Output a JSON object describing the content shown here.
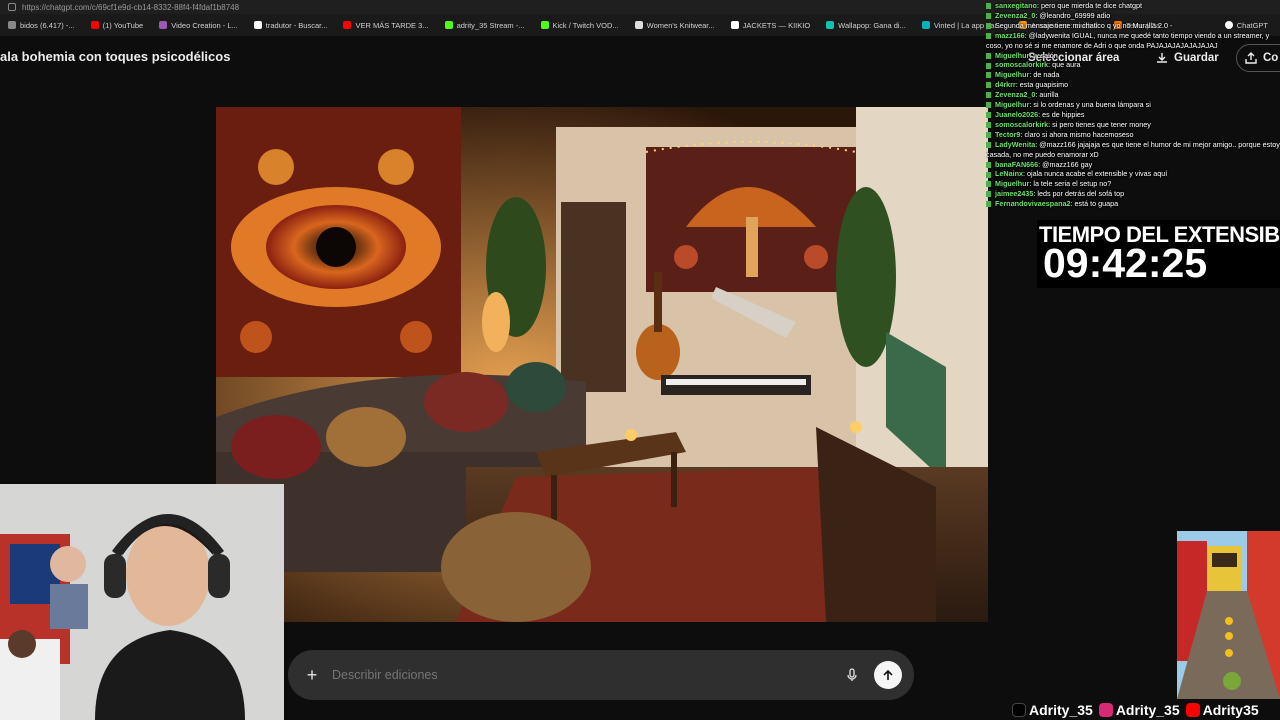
{
  "browser": {
    "url": "https://chatgpt.com/c/69cf1e9d-cb14-8332-88f4-f4fdaf1b8748",
    "bookmarks": [
      {
        "label": "bidos (6.417) -...",
        "color": "#888888"
      },
      {
        "label": "(1) YouTube",
        "color": "#ff0000"
      },
      {
        "label": "Video Creation - L...",
        "color": "#9b59b6"
      },
      {
        "label": "tradutor - Buscar...",
        "color": "#ffffff"
      },
      {
        "label": "VER MÁS TARDE 3...",
        "color": "#ff0000"
      },
      {
        "label": "adrity_35 Stream -...",
        "color": "#53fc18"
      },
      {
        "label": "Kick / Twitch VOD...",
        "color": "#53fc18"
      },
      {
        "label": "Women's Knitwear...",
        "color": "#dddddd"
      },
      {
        "label": "JACKETS — KIIKIO",
        "color": "#ffffff"
      },
      {
        "label": "Wallapop: Gana di...",
        "color": "#13c1ac"
      },
      {
        "label": "Vinted | La app par...",
        "color": "#09b1ba"
      },
      {
        "label": "Amazon.es : swith 2",
        "color": "#ff9900"
      },
      {
        "label": "Temu | Ca",
        "color": "#fb7701"
      }
    ],
    "right_bookmark": "ChatGPT"
  },
  "header": {
    "title": "ala bohemia con toques psicodélicos",
    "select_area": "Seleccionar área",
    "save": "Guardar",
    "share": "Co"
  },
  "composer": {
    "placeholder": "Describir ediciones"
  },
  "chat": [
    {
      "user": "sanxegitano",
      "msg": "pero que mierda te dice chatgpt"
    },
    {
      "user": "Zevenza2_0",
      "msg": "@leandro_69999 adio"
    },
    {
      "user": "",
      "msg": "Segunda mensaje tiene mi chatico q yo no Muralla 2.0 -"
    },
    {
      "user": "mazz166",
      "msg": "@ladywenita IGUAL, nunca me quedé tanto tiempo viendo a un streamer, y coso, yo no sé si me enamore de Adri o que onda PAJAJAJAJAJAJAJAJ"
    },
    {
      "user": "Miguelhur",
      "msg": "w salón"
    },
    {
      "user": "somoscalorkirk",
      "msg": "que aura"
    },
    {
      "user": "Miguelhur",
      "msg": "de nada"
    },
    {
      "user": "d4rkrr",
      "msg": "esta guapisimo"
    },
    {
      "user": "Zevenza2_0",
      "msg": "aurilla"
    },
    {
      "user": "Miguelhur",
      "msg": "si lo ordenas y una buena lámpara si"
    },
    {
      "user": "Juanelo2026",
      "msg": "es de hippies"
    },
    {
      "user": "somoscalorkirk",
      "msg": "si pero tienes que tener money"
    },
    {
      "user": "Tector9",
      "msg": "claro si ahora mismo hacemoseso"
    },
    {
      "user": "LadyWenita",
      "msg": "@mazz166 jajajaja es que tiene el humor de mi mejor amigo.. porque estoy casada, no me puedo enamorar xD"
    },
    {
      "user": "banaFAN666",
      "msg": "@mazz166 gay"
    },
    {
      "user": "LeNainx",
      "msg": "ojala nunca acabe el extensible y vivas aquí"
    },
    {
      "user": "Miguelhur",
      "msg": "la tele seria el setup no?"
    },
    {
      "user": "jaimee2435",
      "msg": "leds por detrás del sofá top"
    },
    {
      "user": "Fernandovivaespana2",
      "msg": "está to guapa"
    }
  ],
  "timer": {
    "label": "TIEMPO DEL EXTENSIBLE:",
    "value": "09:42:25"
  },
  "socials": [
    {
      "handle": "Adrity_35",
      "icon": "tiktok-icon",
      "color": "#000000"
    },
    {
      "handle": "Adrity_35",
      "icon": "instagram-icon",
      "color": "#d62976"
    },
    {
      "handle": "Adrity35",
      "icon": "youtube-icon",
      "color": "#ff0000"
    }
  ]
}
